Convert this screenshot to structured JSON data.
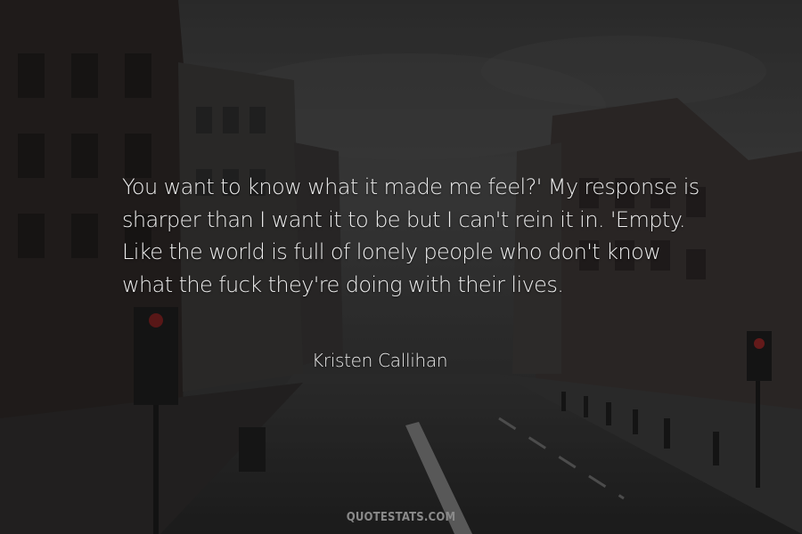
{
  "quote": {
    "text": "You want to know what it made me feel?' My response is sharper than I want it to be but I can't rein it in. 'Empty. Like the world is full of lonely people who don't know what the fuck they're doing with their lives."
  },
  "author": {
    "name": "Kristen Callihan"
  },
  "watermark": {
    "text": "QUOTESTATS.COM"
  },
  "colors": {
    "text": "#eeeeee",
    "background": "#2a2a2a"
  }
}
